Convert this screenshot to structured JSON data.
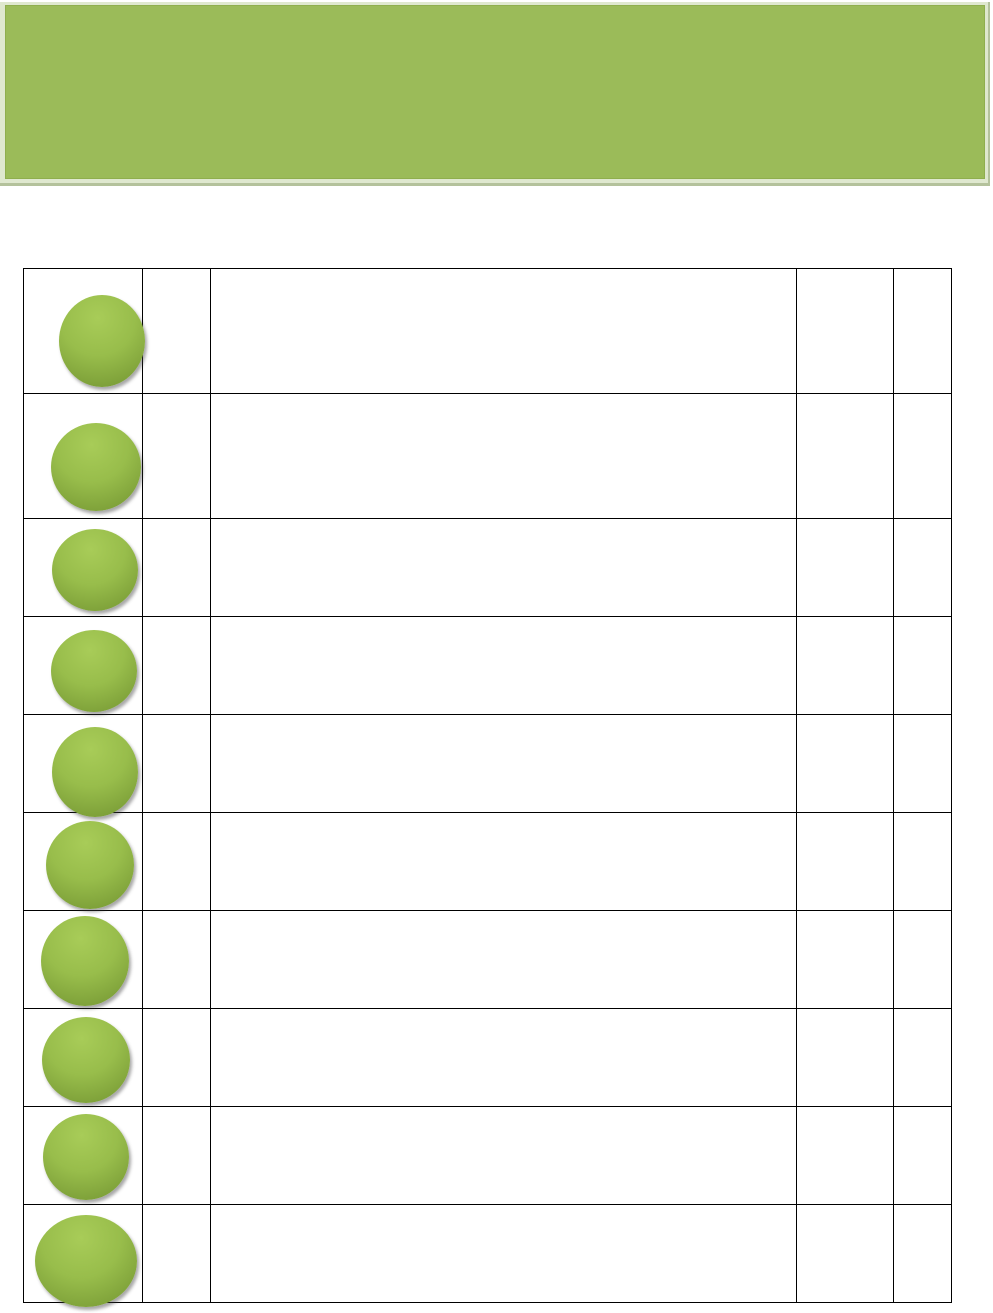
{
  "header": {
    "title": ""
  },
  "rows": [
    {
      "circle_label": "",
      "number": "",
      "description": "",
      "col_a": "",
      "col_b": ""
    },
    {
      "circle_label": "",
      "number": "",
      "description": "",
      "col_a": "",
      "col_b": ""
    },
    {
      "circle_label": "",
      "number": "",
      "description": "",
      "col_a": "",
      "col_b": ""
    },
    {
      "circle_label": "",
      "number": "",
      "description": "",
      "col_a": "",
      "col_b": ""
    },
    {
      "circle_label": "",
      "number": "",
      "description": "",
      "col_a": "",
      "col_b": ""
    },
    {
      "circle_label": "",
      "number": "",
      "description": "",
      "col_a": "",
      "col_b": ""
    },
    {
      "circle_label": "",
      "number": "",
      "description": "",
      "col_a": "",
      "col_b": ""
    },
    {
      "circle_label": "",
      "number": "",
      "description": "",
      "col_a": "",
      "col_b": ""
    },
    {
      "circle_label": "",
      "number": "",
      "description": "",
      "col_a": "",
      "col_b": ""
    },
    {
      "circle_label": "",
      "number": "",
      "description": "",
      "col_a": "",
      "col_b": ""
    }
  ],
  "colors": {
    "banner": "#9bbb59",
    "circle": "#98bd4b",
    "grid_line": "#000000"
  }
}
